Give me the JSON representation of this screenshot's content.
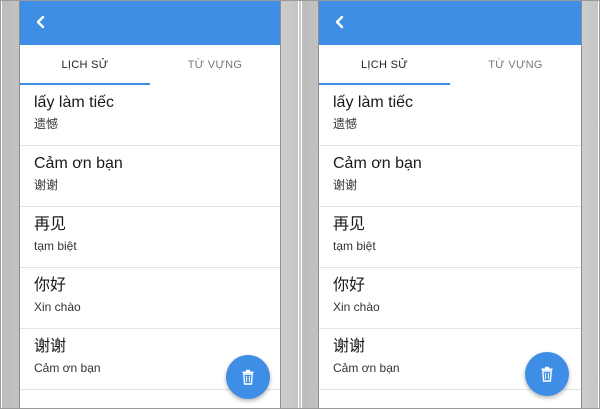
{
  "colors": {
    "accent": "#3f8ee6",
    "list_background": "#ffffff",
    "divider": "#e3e3e3"
  },
  "icons": {
    "back": "chevron-left-icon",
    "delete": "trash-icon"
  },
  "screens": [
    {
      "tabs": [
        {
          "label": "LỊCH SỬ",
          "active": true
        },
        {
          "label": "TỪ VỰNG",
          "active": false
        }
      ],
      "items": [
        {
          "word": "lấy làm tiếc",
          "meaning": "遗憾"
        },
        {
          "word": "Cảm ơn bạn",
          "meaning": "谢谢"
        },
        {
          "word": "再见",
          "meaning": "tạm biệt"
        },
        {
          "word": "你好",
          "meaning": "Xin chào"
        },
        {
          "word": "谢谢",
          "meaning": "Cảm ơn bạn"
        }
      ]
    },
    {
      "tabs": [
        {
          "label": "LỊCH SỬ",
          "active": true
        },
        {
          "label": "TỪ VỰNG",
          "active": false
        }
      ],
      "items": [
        {
          "word": "lấy làm tiếc",
          "meaning": "遗憾"
        },
        {
          "word": "Cảm ơn bạn",
          "meaning": "谢谢"
        },
        {
          "word": "再见",
          "meaning": "tạm biệt"
        },
        {
          "word": "你好",
          "meaning": "Xin chào"
        },
        {
          "word": "谢谢",
          "meaning": "Cảm ơn bạn"
        }
      ]
    }
  ]
}
